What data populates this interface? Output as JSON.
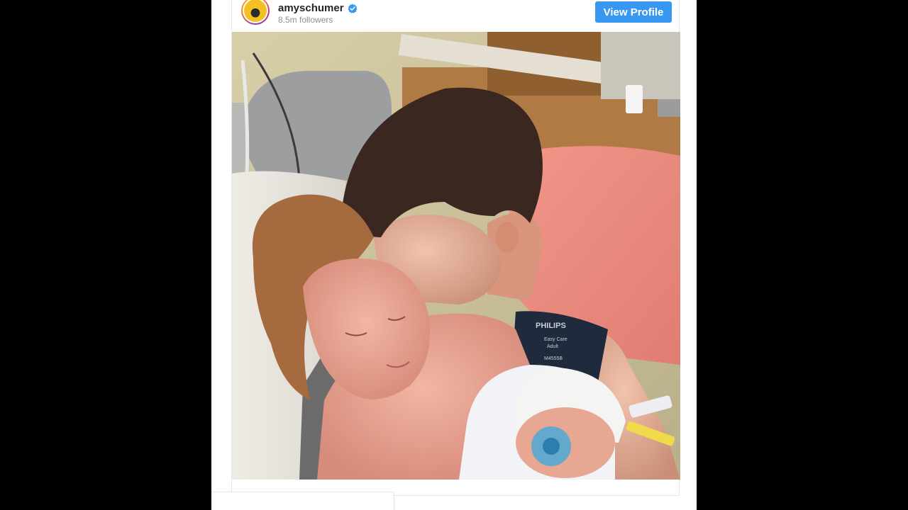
{
  "profile": {
    "username": "amyschumer",
    "followers": "8.5m followers",
    "verified": true,
    "view_profile_label": "View Profile"
  },
  "colors": {
    "accent": "#3897f0",
    "username": "#262626",
    "muted": "#8e8e8e",
    "background": "#000000"
  },
  "photo": {
    "monitor_text": {
      "brand": "PHILIPS",
      "line1": "Easy Care",
      "line2": "Adult",
      "code": "M4555B"
    }
  },
  "icons": {
    "verified": "verified-badge-icon"
  }
}
